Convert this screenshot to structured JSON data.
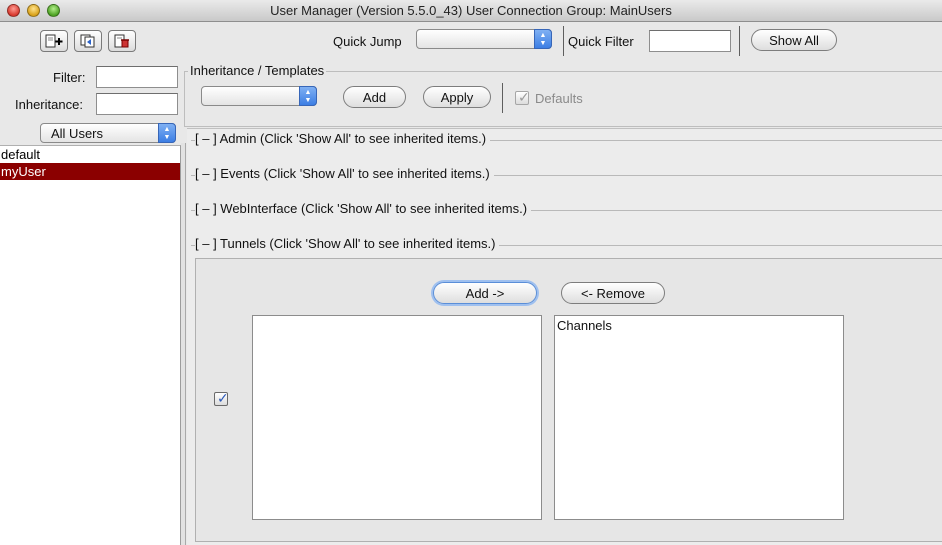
{
  "window": {
    "title": "User Manager (Version 5.5.0_43) User Connection Group: MainUsers"
  },
  "toolbar": {
    "new_user_icon": "new-document-plus-icon",
    "copy_user_icon": "copy-document-icon",
    "delete_user_icon": "delete-document-icon",
    "quick_jump_label": "Quick Jump",
    "quick_jump_value": "",
    "quick_filter_label": "Quick Filter",
    "quick_filter_value": "",
    "show_all_label": "Show All"
  },
  "filters": {
    "filter_label": "Filter:",
    "filter_value": "",
    "inheritance_label": "Inheritance:",
    "inheritance_value": ""
  },
  "inheritance_templates": {
    "legend": "Inheritance / Templates",
    "template_value": "",
    "add_label": "Add",
    "apply_label": "Apply",
    "defaults_label": "Defaults",
    "defaults_checked": true
  },
  "user_filter": {
    "selected": "All Users"
  },
  "users": [
    {
      "name": "default",
      "selected": false
    },
    {
      "name": "myUser",
      "selected": true
    }
  ],
  "sections": [
    {
      "label": "[ – ] Admin (Click 'Show All' to see inherited items.)"
    },
    {
      "label": "[ – ] Events (Click 'Show All' to see inherited items.)"
    },
    {
      "label": "[ – ] WebInterface (Click 'Show All' to see inherited items.)"
    },
    {
      "label": "[ – ] Tunnels (Click 'Show All' to see inherited items.)"
    }
  ],
  "tunnels": {
    "add_label": "Add ->",
    "remove_label": "<- Remove",
    "available_items": [],
    "selected_header": "Channels",
    "enabled_checked": true
  },
  "colors": {
    "selection": "#8b0000",
    "focus": "#5a8ed8"
  }
}
